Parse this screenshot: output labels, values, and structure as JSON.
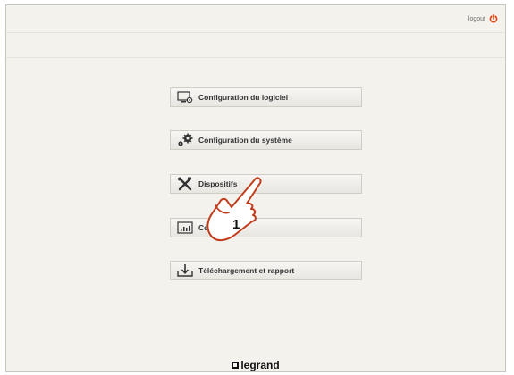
{
  "header": {
    "logout_label": "logout",
    "logout_icon": "power-icon",
    "accent": "#d9481a"
  },
  "menu": {
    "items": [
      {
        "label": "Configuration du logiciel",
        "icon": "monitor-gear-icon"
      },
      {
        "label": "Configuration du système",
        "icon": "gears-icon"
      },
      {
        "label": "Dispositifs",
        "icon": "tools-icon"
      },
      {
        "label": "Co",
        "label_end": "ns",
        "icon": "chart-icon"
      },
      {
        "label": "Téléchargement et rapport",
        "icon": "download-icon"
      }
    ]
  },
  "annotation": {
    "step_number": "1",
    "icon": "pointing-hand-icon"
  },
  "footer": {
    "logo_text": "legrand"
  }
}
